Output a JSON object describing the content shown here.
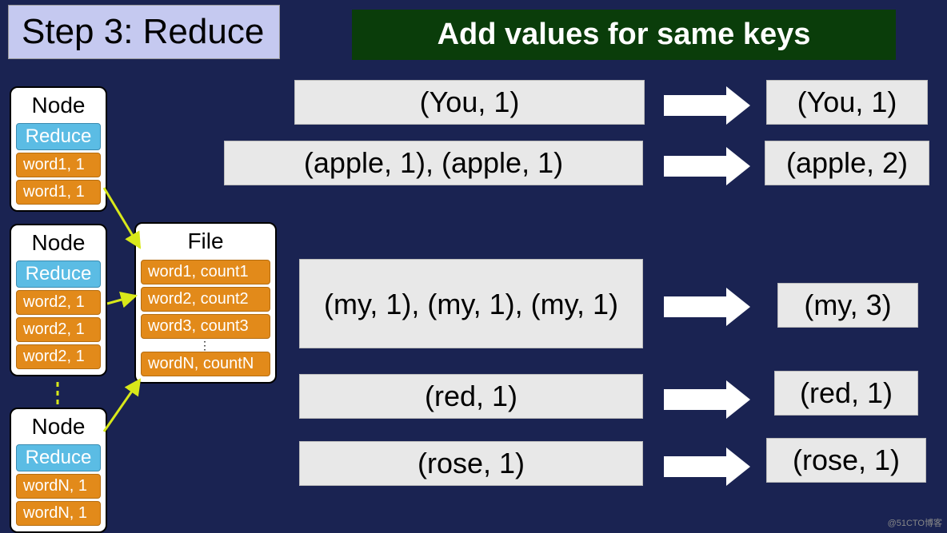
{
  "header": {
    "title": "Step 3: Reduce",
    "subtitle": "Add values for same keys"
  },
  "nodes": [
    {
      "title": "Node",
      "label": "Reduce",
      "items": [
        "word1, 1",
        "word1, 1"
      ]
    },
    {
      "title": "Node",
      "label": "Reduce",
      "items": [
        "word2, 1",
        "word2, 1",
        "word2, 1"
      ]
    },
    {
      "title": "Node",
      "label": "Reduce",
      "items": [
        "wordN, 1",
        "wordN, 1"
      ]
    }
  ],
  "file": {
    "title": "File",
    "items": [
      "word1, count1",
      "word2, count2",
      "word3, count3",
      "wordN, countN"
    ]
  },
  "examples": [
    {
      "input": "(You, 1)",
      "output": "(You, 1)"
    },
    {
      "input": "(apple, 1), (apple, 1)",
      "output": "(apple, 2)"
    },
    {
      "input": "(my, 1), (my, 1), (my, 1)",
      "output": "(my, 3)"
    },
    {
      "input": "(red, 1)",
      "output": "(red, 1)"
    },
    {
      "input": "(rose, 1)",
      "output": "(rose, 1)"
    }
  ],
  "watermark": "@51CTO博客"
}
